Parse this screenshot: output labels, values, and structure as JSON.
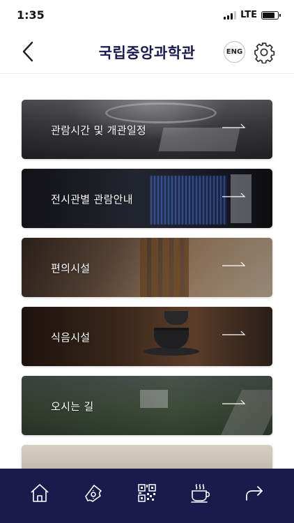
{
  "status_bar": {
    "time": "1:35",
    "network": "LTE"
  },
  "header": {
    "title": "국립중앙과학관",
    "lang_button": "ENG"
  },
  "menu": [
    {
      "label": "관람시간 및 개관일정"
    },
    {
      "label": "전시관별 관람안내"
    },
    {
      "label": "편의시설"
    },
    {
      "label": "식음시설"
    },
    {
      "label": "오시는 길"
    },
    {
      "label": ""
    }
  ],
  "tabbar": {
    "icons": [
      "home-icon",
      "ticket-icon",
      "qr-code-icon",
      "coffee-cup-icon",
      "share-icon"
    ]
  },
  "colors": {
    "brand_navy": "#1a1a4d",
    "title": "#1a1a4e"
  }
}
